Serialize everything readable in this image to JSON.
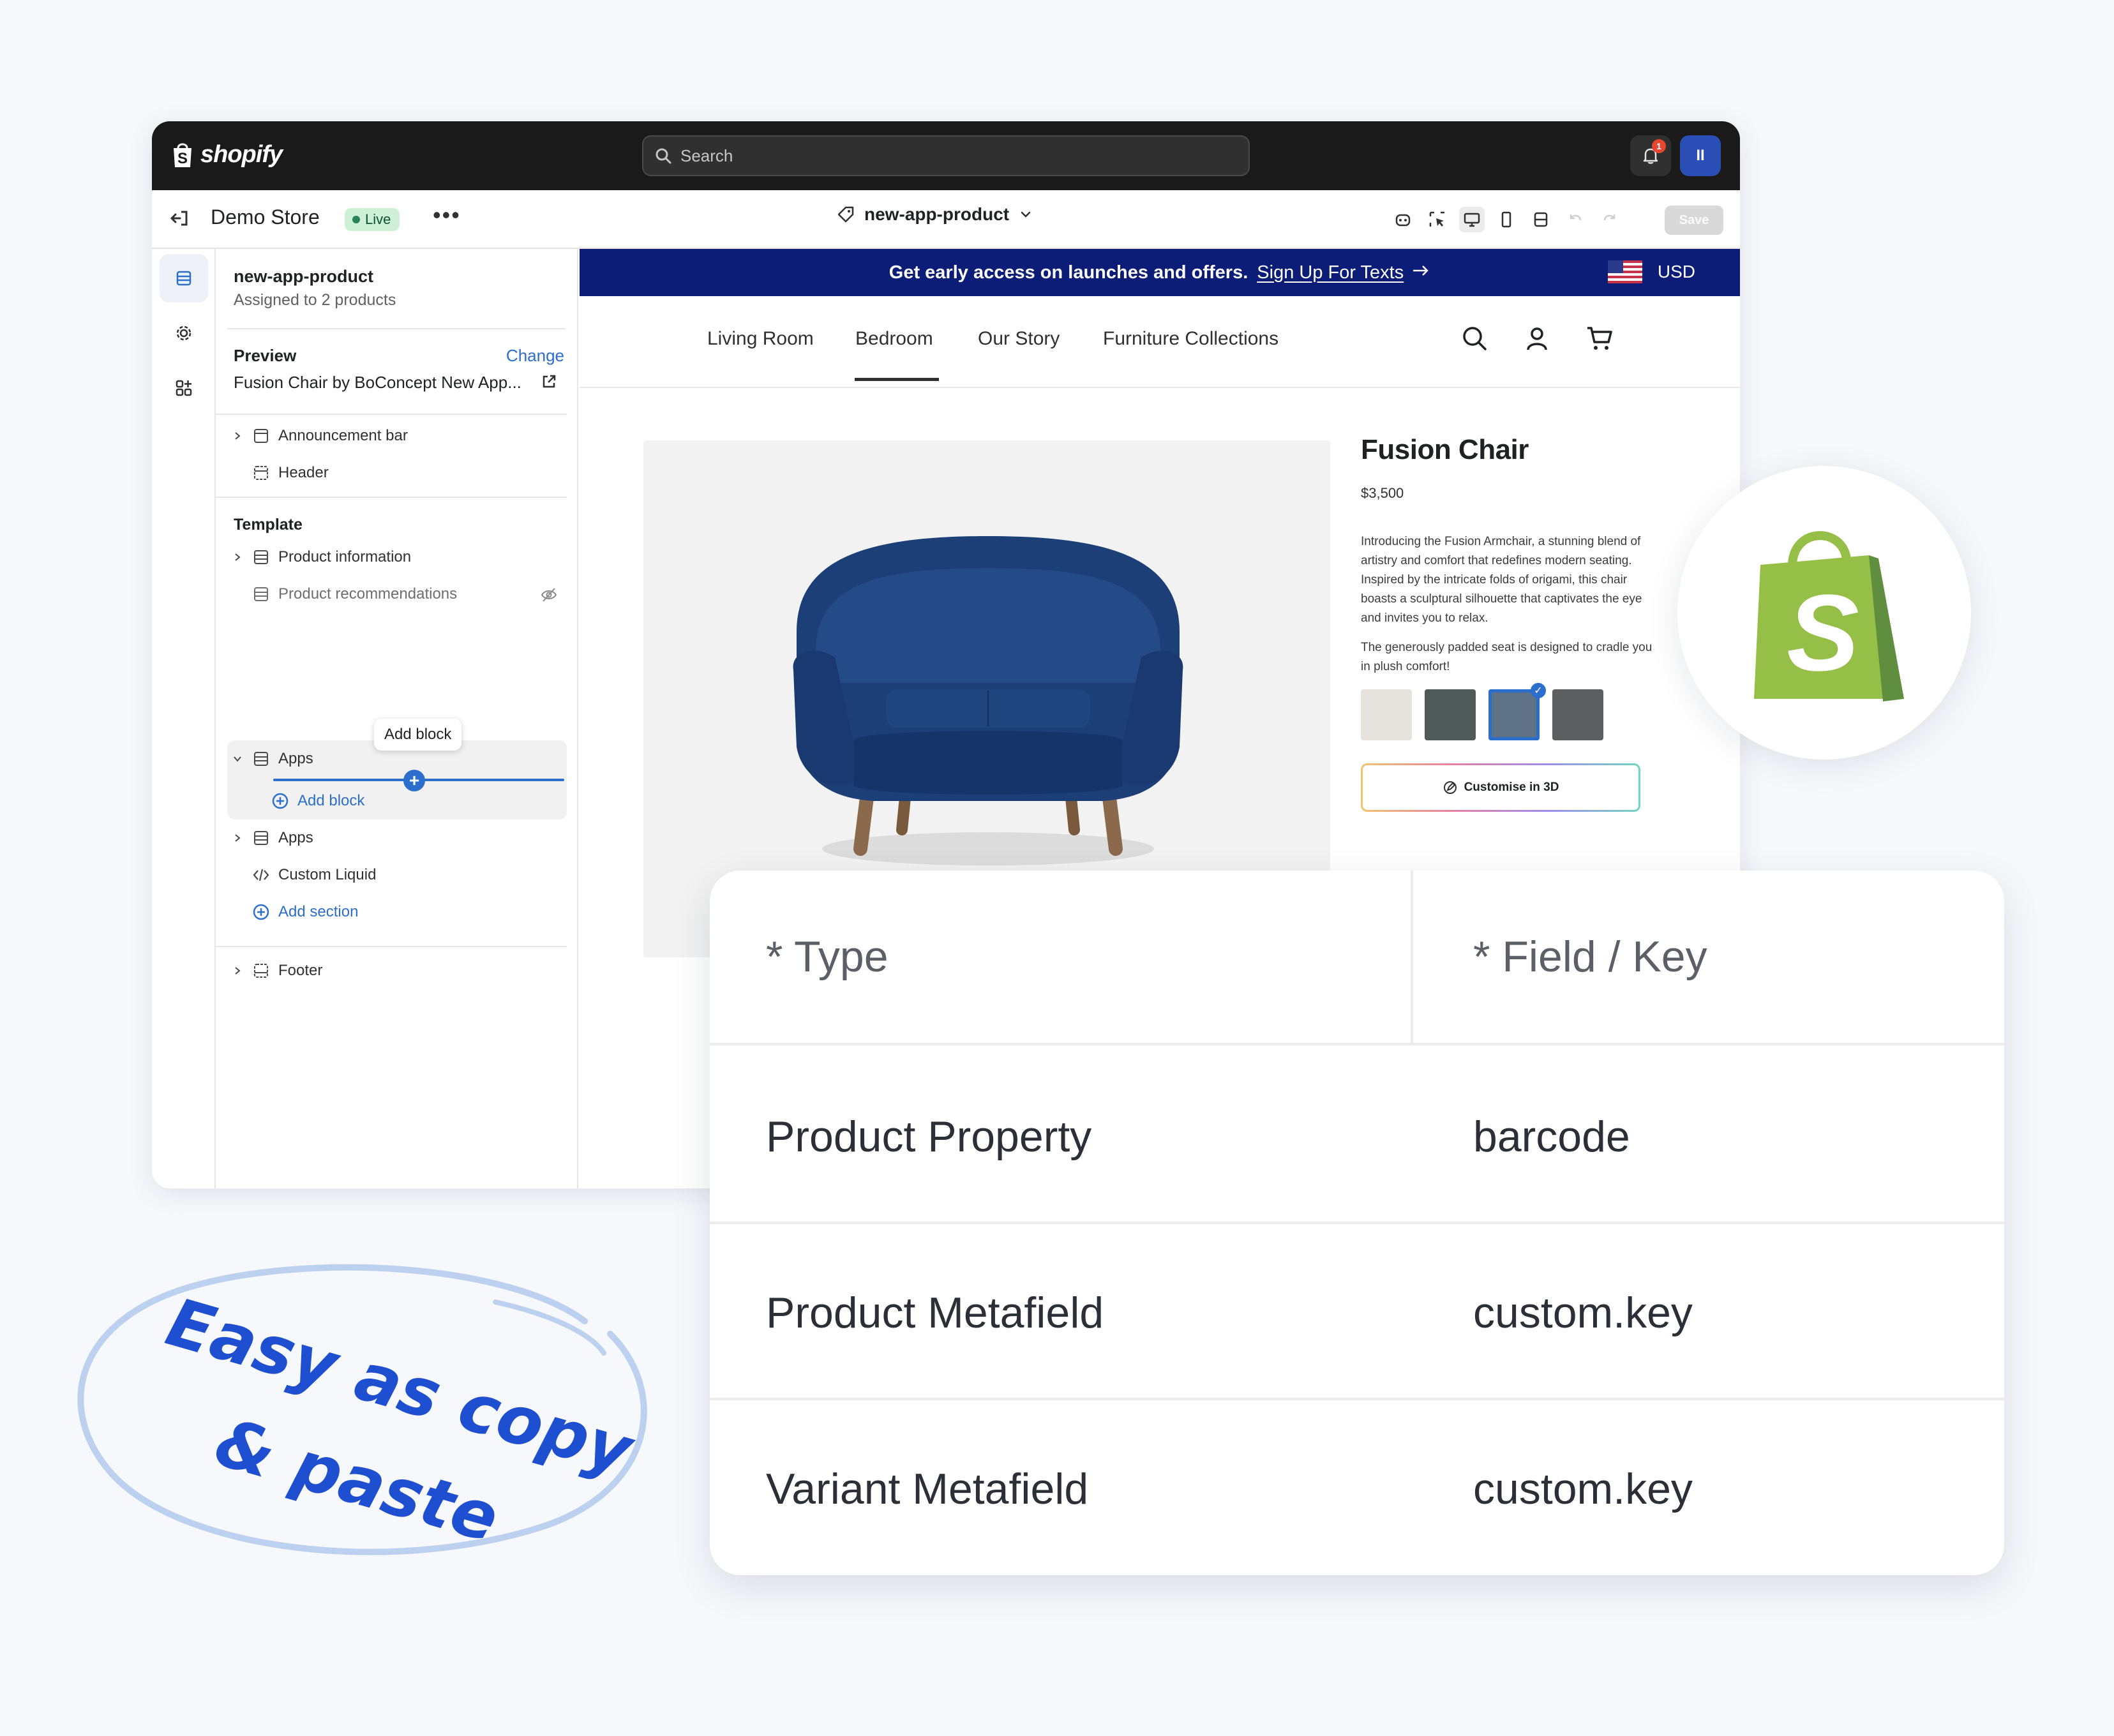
{
  "topbar": {
    "logo_text": "shopify",
    "search_placeholder": "Search",
    "notification_count": "1",
    "avatar_initials": "II"
  },
  "toolbar": {
    "store_name": "Demo Store",
    "status_badge": "Live",
    "more_label": "•••",
    "template_name": "new-app-product",
    "save_label": "Save"
  },
  "sidebar": {
    "template_title": "new-app-product",
    "template_subtitle": "Assigned to 2 products",
    "preview_label": "Preview",
    "preview_change": "Change",
    "preview_product": "Fusion Chair by BoConcept New App...",
    "items": {
      "announcement_bar": "Announcement bar",
      "header": "Header",
      "template_label": "Template",
      "product_information": "Product information",
      "product_recommendations": "Product recommendations",
      "apps_1": "Apps",
      "add_block": "Add block",
      "tooltip_add_block": "Add block",
      "apps_2": "Apps",
      "custom_liquid": "Custom Liquid",
      "add_section": "Add section",
      "footer": "Footer"
    }
  },
  "storefront": {
    "announcement_bold": "Get early access on launches and offers.",
    "announcement_link": "Sign Up For Texts",
    "currency": "USD",
    "nav": [
      "Living Room",
      "Bedroom",
      "Our Story",
      "Furniture Collections"
    ],
    "active_nav": "Bedroom",
    "product": {
      "name": "Fusion Chair",
      "price": "$3,500",
      "desc_1": "Introducing the Fusion Armchair, a stunning blend of artistry and comfort that redefines modern seating. Inspired by the intricate folds of origami, this chair boasts a sculptural silhouette that captivates the eye and invites you to relax.",
      "desc_2": "The generously padded seat is designed to cradle you in plush comfort!",
      "swatch_colors": [
        "#e6e3de",
        "#4f5a58",
        "#5f7286",
        "#5d5f61"
      ],
      "selected_swatch": 3,
      "customise_label": "Customise in 3D"
    }
  },
  "mapping_table": {
    "headers": [
      "* Type",
      "* Field / Key"
    ],
    "rows": [
      [
        "Product Property",
        "barcode"
      ],
      [
        "Product Metafield",
        "custom.key"
      ],
      [
        "Variant Metafield",
        "custom.key"
      ]
    ]
  },
  "callout": {
    "line_1": "Easy as copy",
    "line_2": "& paste"
  },
  "colors": {
    "accent_blue": "#2c6ecb",
    "announcement_bg": "#0b1d77",
    "shopify_green": "#95bf47",
    "handwriting_blue": "#1f4fd1"
  }
}
